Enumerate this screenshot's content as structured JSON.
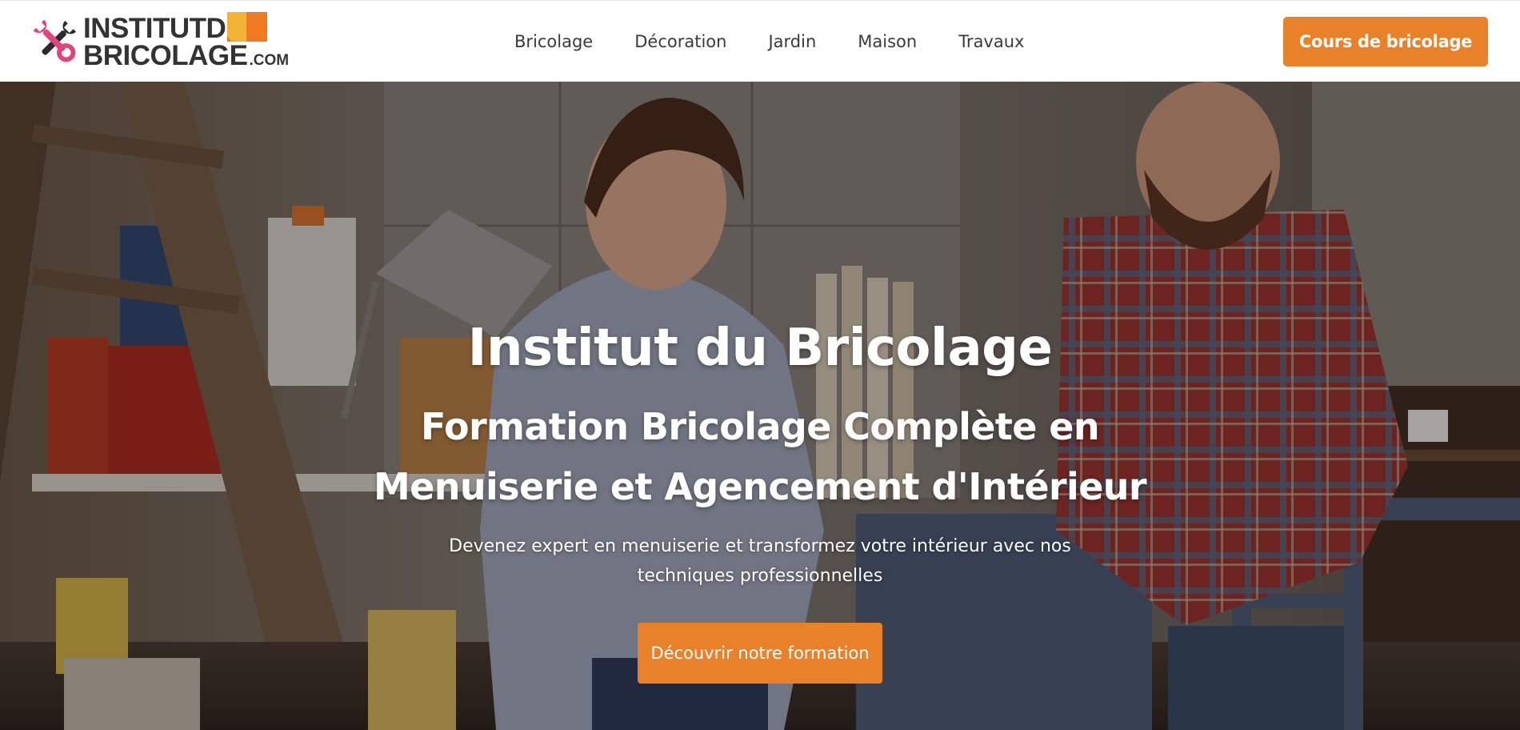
{
  "header": {
    "logo": {
      "line1": "INSTITUTD",
      "line2": "BRICOLAGE",
      "suffix": ".COM"
    },
    "nav": [
      {
        "label": "Bricolage"
      },
      {
        "label": "Décoration"
      },
      {
        "label": "Jardin"
      },
      {
        "label": "Maison"
      },
      {
        "label": "Travaux"
      }
    ],
    "cta_label": "Cours de bricolage"
  },
  "hero": {
    "title": "Institut du Bricolage",
    "subtitle": "Formation Bricolage Complète en Menuiserie et Agencement d'Intérieur",
    "description": "Devenez expert en menuiserie et transformez votre intérieur avec nos techniques professionnelles",
    "cta_label": "Découvrir notre formation",
    "background_icon": "workshop-photo"
  },
  "colors": {
    "accent": "#e8812a",
    "logo_pink": "#e2457a",
    "logo_yellow": "#f2b233",
    "logo_orange": "#ef7a22",
    "text_dark": "#333333"
  }
}
